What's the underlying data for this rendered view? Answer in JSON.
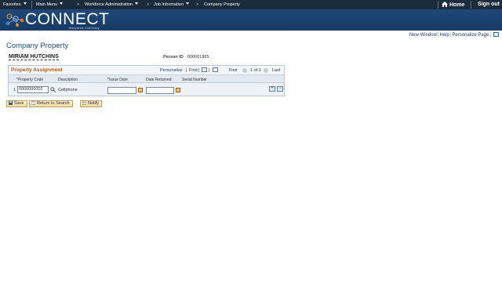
{
  "topnav": {
    "favorites": "Favorites",
    "main_menu": "Main Menu",
    "workforce_admin": "Workforce Administration",
    "job_information": "Job Information",
    "current": "Company Property",
    "separator": ">",
    "home": "Home",
    "sign_out": "Sign out"
  },
  "banner": {
    "logo": "CONNECT",
    "subtitle": "Maryland Judiciary"
  },
  "utility": {
    "new_window": "New Window",
    "help": "Help",
    "personalize_page": "Personalize Page",
    "pipe": "|"
  },
  "page": {
    "title": "Company Property",
    "employee_name": "MIRIAM HUTCHINS",
    "person_id_label": "Person ID",
    "person_id": "000001865"
  },
  "grid": {
    "title": "Property Assignment",
    "personalize": "Personalize",
    "find": "Find",
    "first": "First",
    "range": "1 of 1",
    "last": "Last",
    "columns": [
      "*Property Code",
      "Description",
      "*Issue Date",
      "Date Returned",
      "Serial Number"
    ],
    "rows": [
      {
        "num": "1",
        "property_code": "0000000002",
        "description": "Cellphone",
        "issue_date": "",
        "date_returned": "",
        "serial_number": ""
      }
    ]
  },
  "actions": {
    "save": "Save",
    "return_to_search": "Return to Search",
    "notify": "Notify"
  },
  "colors": {
    "topbar": "#1c2c3c",
    "banner": "#1f4a7a",
    "title": "#1b4d8c",
    "grid_title": "#b8590c"
  }
}
